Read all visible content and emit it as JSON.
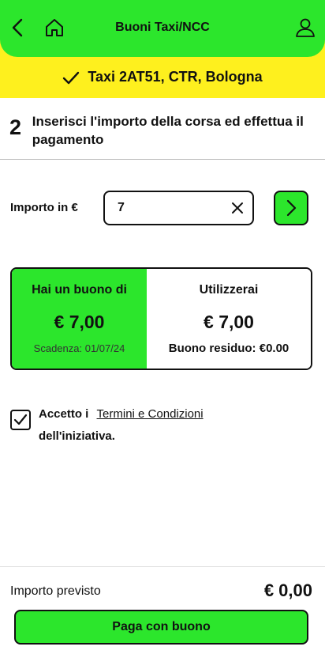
{
  "header": {
    "title": "Buoni Taxi/NCC",
    "back_icon": "chevron-left-icon",
    "home_icon": "home-icon",
    "profile_icon": "user-icon",
    "color": "#2ce62c"
  },
  "confirmation": {
    "icon": "check-icon",
    "text": "Taxi 2AT51, CTR, Bologna",
    "color": "#fef01e"
  },
  "step": {
    "number": "2",
    "text": "Inserisci l'importo della corsa ed effettua il pagamento"
  },
  "amount": {
    "label": "Importo in €",
    "value": "7",
    "clear_icon": "close-icon",
    "submit_icon": "chevron-right-icon"
  },
  "voucher": {
    "left_caption": "Hai un buono di",
    "left_amount": "€ 7,00",
    "expiry": "Scadenza: 01/07/24",
    "right_caption": "Utilizzerai",
    "right_amount": "€ 7,00",
    "remaining": "Buono residuo: €0.00"
  },
  "terms": {
    "checked": true,
    "prefix": "Accetto i",
    "link": "Termini e Condizioni",
    "suffix": "dell'iniziativa."
  },
  "footer": {
    "label": "Importo previsto",
    "total": "€ 0,00",
    "pay_button": "Paga con buono"
  }
}
